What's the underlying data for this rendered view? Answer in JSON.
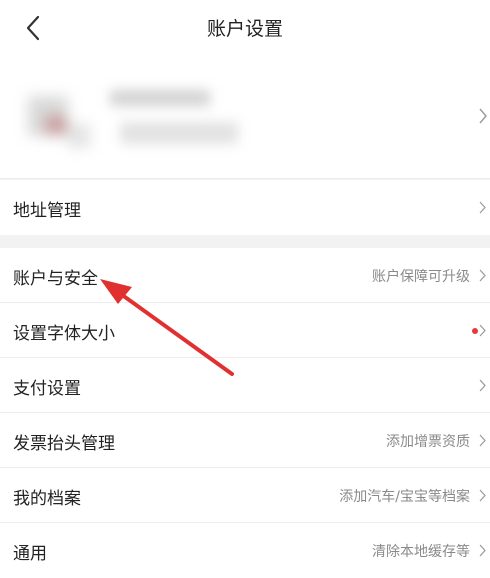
{
  "header": {
    "title": "账户设置",
    "back_icon": "chevron-left-icon"
  },
  "profile": {
    "avatar": "blurred-avatar",
    "chevron_icon": "chevron-right-icon"
  },
  "rows": [
    {
      "label": "地址管理",
      "value": "",
      "chevron_icon": "chevron-right-icon"
    },
    {
      "label": "账户与安全",
      "value": "账户保障可升级",
      "chevron_icon": "chevron-right-icon"
    },
    {
      "label": "设置字体大小",
      "value": "",
      "badge": "red-dot",
      "chevron_icon": "chevron-right-icon"
    },
    {
      "label": "支付设置",
      "value": "",
      "chevron_icon": "chevron-right-icon"
    },
    {
      "label": "发票抬头管理",
      "value": "添加增票资质",
      "chevron_icon": "chevron-right-icon"
    },
    {
      "label": "我的档案",
      "value": "添加汽车/宝宝等档案",
      "chevron_icon": "chevron-right-icon"
    },
    {
      "label": "通用",
      "value": "清除本地缓存等",
      "chevron_icon": "chevron-right-icon"
    }
  ],
  "annotation": {
    "arrow_color": "#e03030",
    "points_to": "账户与安全"
  },
  "colors": {
    "background": "#f2f2f2",
    "accent_dot": "#e5393b"
  }
}
